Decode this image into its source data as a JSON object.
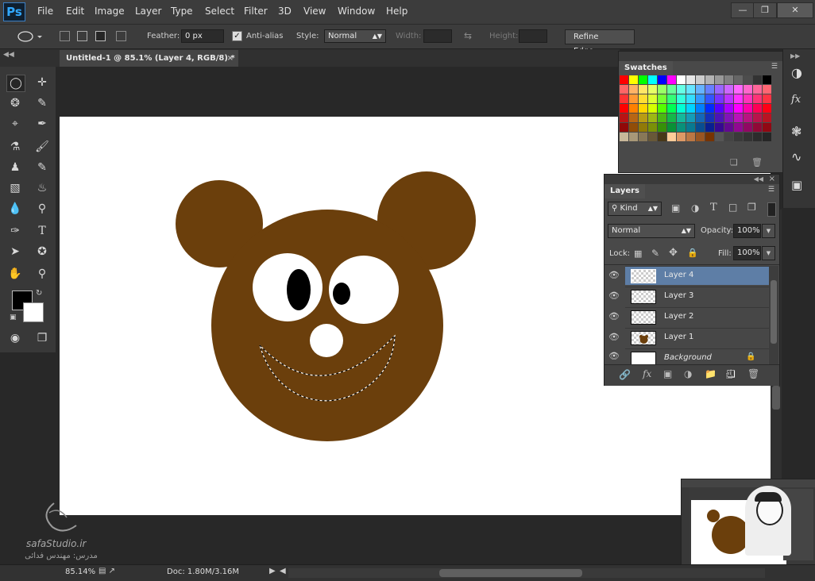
{
  "app": {
    "logo": "Ps"
  },
  "menu": [
    "File",
    "Edit",
    "Image",
    "Layer",
    "Type",
    "Select",
    "Filter",
    "3D",
    "View",
    "Window",
    "Help"
  ],
  "options": {
    "feather_label": "Feather:",
    "feather_value": "0 px",
    "antialias_label": "Anti-alias",
    "style_label": "Style:",
    "style_value": "Normal",
    "width_label": "Width:",
    "height_label": "Height:",
    "refine_edge": "Refine Edge..."
  },
  "document": {
    "tab_title": "Untitled-1 @ 85.1% (Layer 4, RGB/8) *"
  },
  "swatches": {
    "title": "Swatches"
  },
  "layers_panel": {
    "title": "Layers",
    "kind_label": "Kind",
    "blend_mode": "Normal",
    "opacity_label": "Opacity:",
    "opacity_value": "100%",
    "lock_label": "Lock:",
    "fill_label": "Fill:",
    "fill_value": "100%",
    "layers": [
      {
        "name": "Layer 4",
        "selected": true
      },
      {
        "name": "Layer 3",
        "selected": false
      },
      {
        "name": "Layer 2",
        "selected": false
      },
      {
        "name": "Layer 1",
        "selected": false
      },
      {
        "name": "Background",
        "selected": false
      }
    ]
  },
  "status": {
    "zoom": "85.14%",
    "doc_info": "Doc: 1.80M/3.16M"
  },
  "watermark": {
    "site": "safaStudio.ir",
    "instructor": "مدرس: مهندس فدائی"
  },
  "colors": {
    "foreground": "#000000",
    "background": "#ffffff",
    "bear_fur": "#6b3f0c",
    "selected_layer": "#5e7ea6",
    "accent": "#31a8ff"
  }
}
